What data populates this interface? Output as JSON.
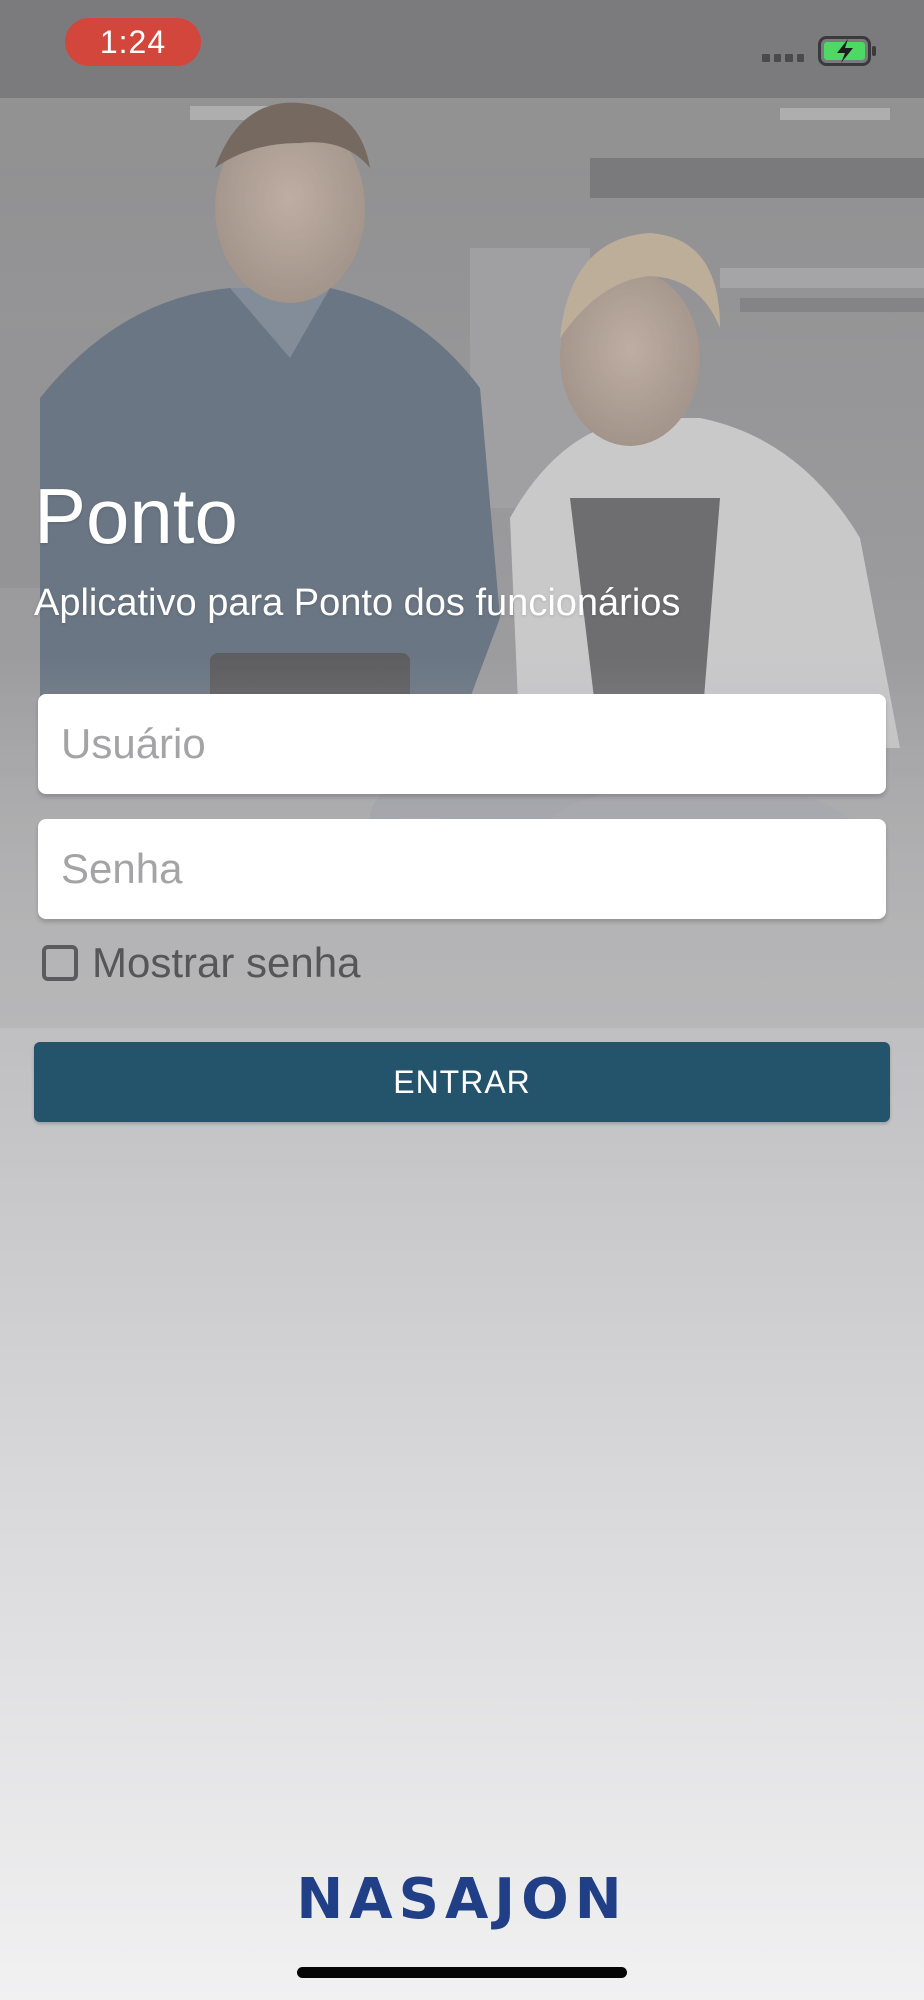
{
  "status_bar": {
    "time": "1:24",
    "time_pill_color": "#d2463c",
    "battery_state": "charging",
    "battery_icon": "battery-charging-icon",
    "signal_icon": "signal-dots-icon"
  },
  "login": {
    "title": "Ponto",
    "subtitle": "Aplicativo para Ponto dos funcionários",
    "username_placeholder": "Usuário",
    "username_value": "",
    "password_placeholder": "Senha",
    "password_value": "",
    "show_password_label": "Mostrar senha",
    "show_password_checked": false,
    "submit_label": "ENTRAR",
    "submit_color": "#24536c"
  },
  "brand": {
    "logo_text": "NASAJON",
    "logo_color": "#203f86"
  }
}
